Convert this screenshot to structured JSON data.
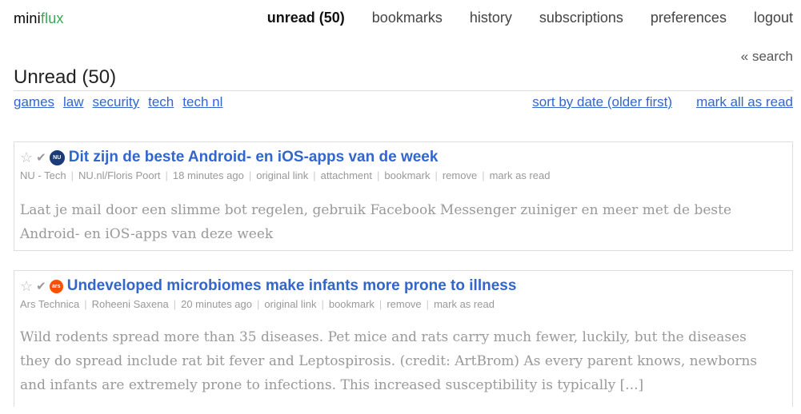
{
  "logo": {
    "part1": "mini",
    "part2": "flux"
  },
  "nav": [
    {
      "label": "unread (50)",
      "active": true
    },
    {
      "label": "bookmarks"
    },
    {
      "label": "history"
    },
    {
      "label": "subscriptions"
    },
    {
      "label": "preferences"
    },
    {
      "label": "logout"
    }
  ],
  "search_link": "« search",
  "page_title": "Unread (50)",
  "categories": [
    "games",
    "law",
    "security",
    "tech",
    "tech nl"
  ],
  "toolbar": {
    "sort": "sort by date (older first)",
    "mark_all": "mark all as read"
  },
  "items": [
    {
      "star": "☆",
      "check": "✔",
      "favicon_icon": "nu-favicon",
      "favicon_text": "NU",
      "title": "Dit zijn de beste Android- en iOS-apps van de week",
      "meta": [
        "NU - Tech",
        "NU.nl/Floris Poort",
        "18 minutes ago",
        "original link",
        "attachment",
        "bookmark",
        "remove",
        "mark as read"
      ],
      "content": "Laat je mail door een slimme bot regelen, gebruik Facebook Messenger zuiniger en meer met de beste Android- en iOS-apps van deze week"
    },
    {
      "star": "☆",
      "check": "✔",
      "favicon_icon": "ars-favicon",
      "favicon_text": "ars",
      "title": "Undeveloped microbiomes make infants more prone to illness",
      "meta": [
        "Ars Technica",
        "Roheeni Saxena",
        "20 minutes ago",
        "original link",
        "bookmark",
        "remove",
        "mark as read"
      ],
      "content": "Wild rodents spread more than 35 diseases. Pet mice and rats carry much fewer, luckily, but the diseases they do spread include rat bit fever and Leptospirosis. (credit: ArtBrom) As every parent knows, newborns and infants are extremely prone to infections. This increased susceptibility is typically [...]"
    }
  ],
  "colors": {
    "link": "#3366cc",
    "logo_accent": "#3aa757",
    "muted": "#999999",
    "nu_brand": "#1d3a7a",
    "ars_brand": "#ff4e00"
  }
}
